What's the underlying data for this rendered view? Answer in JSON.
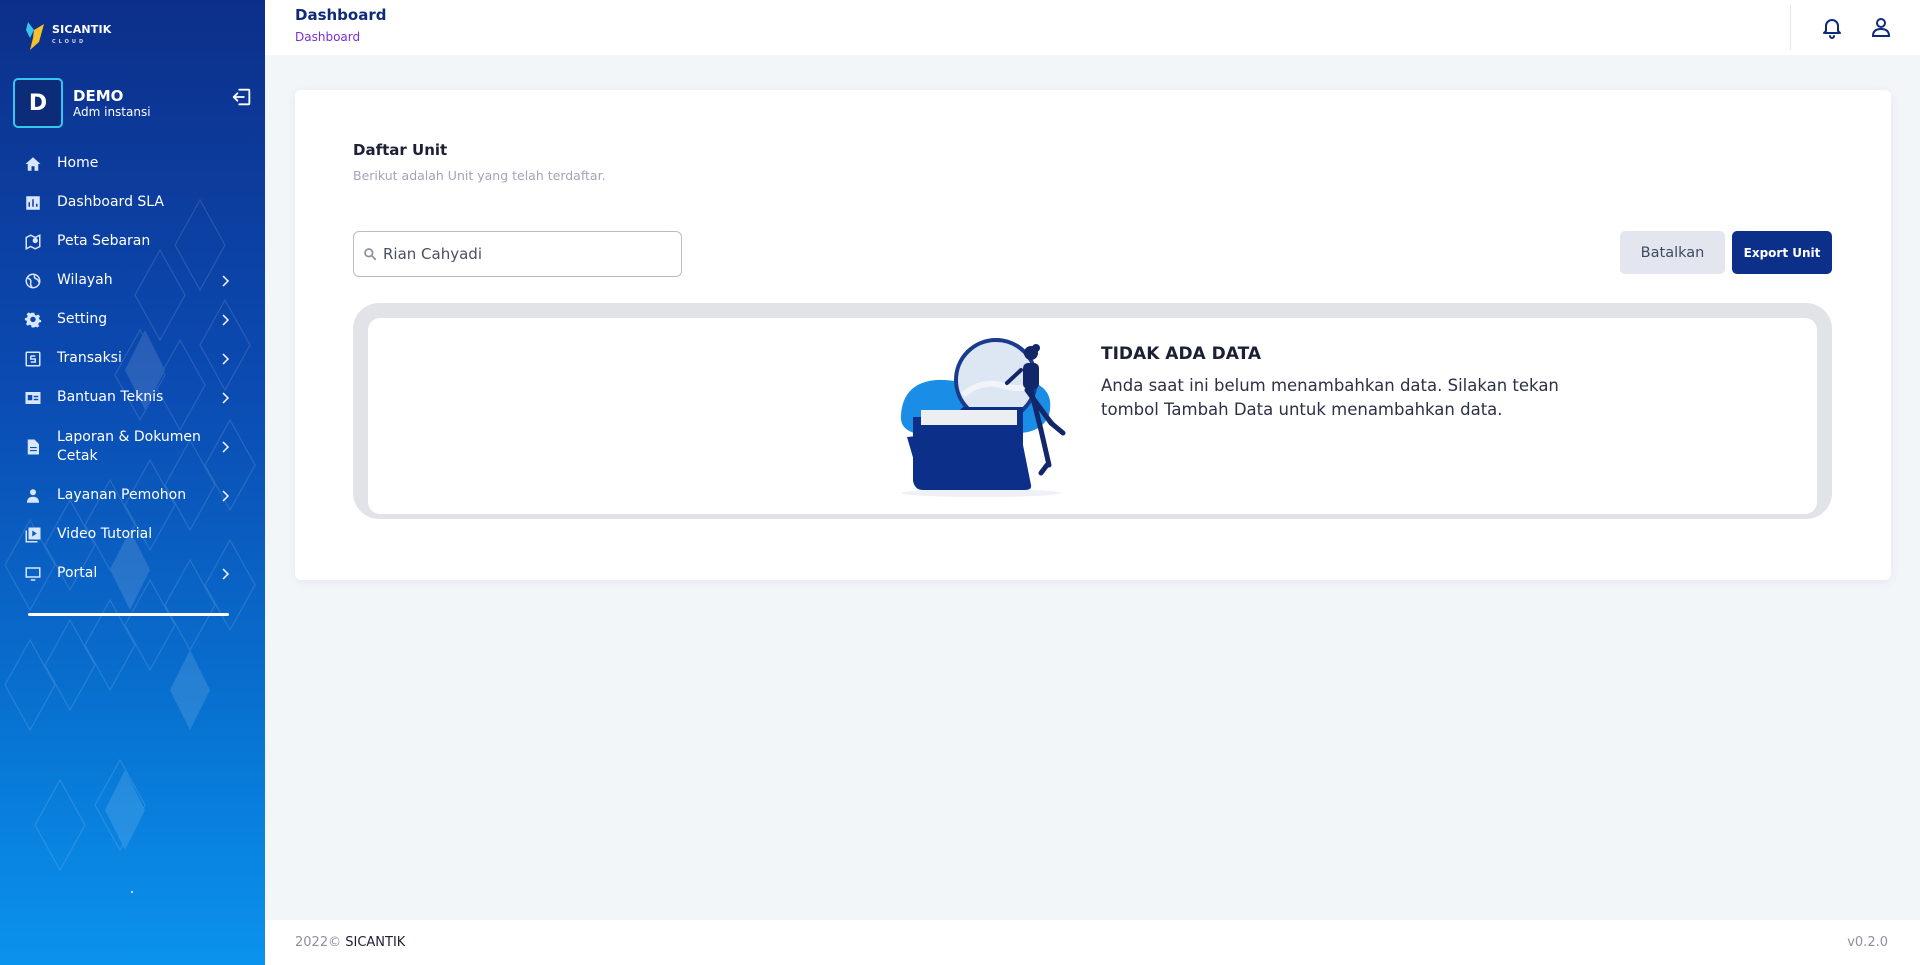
{
  "app": {
    "logo_text": "SICANTIK",
    "logo_sub": "CLOUD"
  },
  "profile": {
    "initial": "D",
    "name": "DEMO",
    "role": "Adm instansi"
  },
  "sidebar": {
    "items": [
      {
        "label": "Home",
        "icon": "home-icon",
        "has_submenu": false
      },
      {
        "label": "Dashboard SLA",
        "icon": "chart-icon",
        "has_submenu": false
      },
      {
        "label": "Peta Sebaran",
        "icon": "map-icon",
        "has_submenu": false
      },
      {
        "label": "Wilayah",
        "icon": "globe-icon",
        "has_submenu": true
      },
      {
        "label": "Setting",
        "icon": "gear-icon",
        "has_submenu": true
      },
      {
        "label": "Transaksi",
        "icon": "receipt-icon",
        "has_submenu": true
      },
      {
        "label": "Bantuan Teknis",
        "icon": "id-card-icon",
        "has_submenu": true
      },
      {
        "label": "Laporan & Dokumen Cetak",
        "icon": "document-icon",
        "has_submenu": true
      },
      {
        "label": "Layanan Pemohon",
        "icon": "user-icon",
        "has_submenu": true
      },
      {
        "label": "Video Tutorial",
        "icon": "video-icon",
        "has_submenu": false
      },
      {
        "label": "Portal",
        "icon": "monitor-icon",
        "has_submenu": true
      }
    ]
  },
  "topbar": {
    "title": "Dashboard",
    "breadcrumb": "Dashboard"
  },
  "card": {
    "title": "Daftar Unit",
    "subtitle": "Berikut adalah Unit yang telah terdaftar.",
    "search": {
      "value": "Rian Cahyadi",
      "placeholder": ""
    },
    "cancel_label": "Batalkan",
    "export_label": "Export Unit",
    "empty": {
      "title": "TIDAK ADA DATA",
      "message": "Anda saat ini belum menambahkan data. Silakan tekan tombol Tambah Data untuk menambahkan data."
    }
  },
  "footer": {
    "year": "2022©",
    "brand": "SICANTIK",
    "version": "v0.2.0"
  },
  "colors": {
    "primary": "#0c2f8a",
    "accent_purple": "#7b2fd6",
    "sidebar_top": "#0c2f8a",
    "sidebar_bottom": "#0a93ee"
  }
}
